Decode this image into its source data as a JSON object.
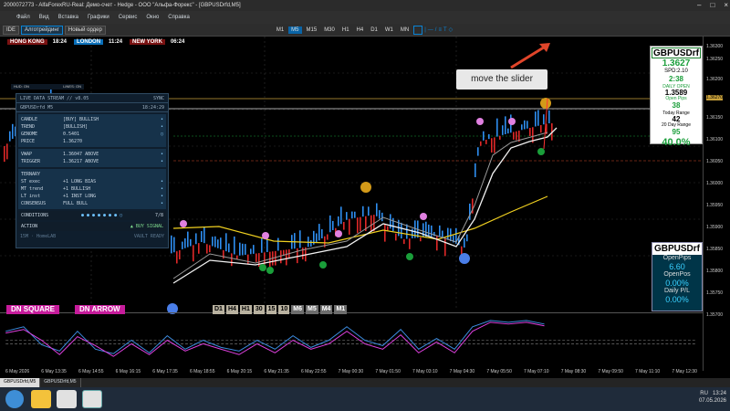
{
  "window": {
    "title": "2000072773 - AlfaForexRU-Real: Демо-счет - Hedge - ООО \"Альфа-Форекс\" - [GBPUSDrfd,M5]"
  },
  "menu": [
    "Файл",
    "Вид",
    "Вставка",
    "Графики",
    "Сервис",
    "Окно",
    "Справка"
  ],
  "toolbar": {
    "ide": "IDE",
    "algo": "Алготрейдинг",
    "new_order": "Новый ордер",
    "timeframes": [
      "M1",
      "M5",
      "M15",
      "M30",
      "H1",
      "H4",
      "D1",
      "W1",
      "MN"
    ],
    "active_tf": "M5"
  },
  "sessions": [
    {
      "name": "HONG KONG",
      "time": "18:24",
      "color": "#7a1212"
    },
    {
      "name": "LONDON",
      "time": "11:24",
      "color": "#0a6fb8"
    },
    {
      "name": "NEW YORK",
      "time": "06:24",
      "color": "#7a1212"
    }
  ],
  "hud": {
    "left": "HUD: ON",
    "right": "LINES: ON"
  },
  "panel": {
    "header": "LIVE DATA STREAM // v8.05",
    "header_right": "SYNC",
    "symbol": "GBPUSDrfd  M5",
    "time": "18:24:29",
    "rows1": [
      {
        "k": "CANDLE",
        "v": "[BUY]  BULLISH",
        "d": "•"
      },
      {
        "k": "TREND",
        "v": "[BULLISH]",
        "d": "•"
      },
      {
        "k": "GENOME",
        "v": "0.5401",
        "d": "○"
      },
      {
        "k": "PRICE",
        "v": "1.36270",
        "d": ""
      }
    ],
    "rows2": [
      {
        "k": "VWAP",
        "v": "1.36047  ABOVE",
        "d": "•"
      },
      {
        "k": "TRIGGER",
        "v": "1.36217  ABOVE",
        "d": "•"
      }
    ],
    "ternary_label": "TERNARY",
    "rows3": [
      {
        "k": "ST  exec",
        "v": "+1  LONG BIAS",
        "d": "•"
      },
      {
        "k": "MT  trend",
        "v": "+1  BULLISH",
        "d": "•"
      },
      {
        "k": "LT  inst",
        "v": "+1  INST LONG",
        "d": "•"
      },
      {
        "k": "CONSENSUS",
        "v": "FULL BULL",
        "d": "•"
      }
    ],
    "conditions_label": "CONDITIONS",
    "conditions_count": "7/8",
    "action_label": "ACTION",
    "action_value": "▲  BUY SIGNAL",
    "footer_left": "15M · HomeLAB",
    "footer_right": "VAULT READY"
  },
  "tags": {
    "dn_square": "DN SQUARE",
    "dn_arrow": "DN ARROW"
  },
  "tf_buttons": [
    "D1",
    "H4",
    "H1",
    "30",
    "15",
    "10",
    "M6",
    "M5",
    "M4",
    "M1"
  ],
  "tooltip": "move the slider",
  "info1": {
    "symbol": "GBPUSDrf",
    "price": "1.3627",
    "spd": "SPD:2.10",
    "timer": "2:38",
    "daily_open_label": "DAILY OPEN",
    "daily_open": "1.3589",
    "open_pips_label": "Open Pips",
    "open_pips": "38",
    "today_range_label": "Today Range",
    "today_range": "42",
    "day20_label": "20 Day Range",
    "day20": "95",
    "pct": "40.0%"
  },
  "info2": {
    "symbol": "GBPUSDrf",
    "open_pips_label": "OpenPips",
    "open_pips": "6.60",
    "open_pos_label": "OpenPos",
    "open_pos": "0.00%",
    "daily_pl_label": "Daily P/L",
    "daily_pl": "0.00%"
  },
  "price_axis": [
    "1.36300",
    "1.36270",
    "1.36250",
    "1.36200",
    "1.36150",
    "1.36100",
    "1.36050",
    "1.36000",
    "1.35950",
    "1.35900",
    "1.35850",
    "1.35800",
    "1.35750",
    "1.35700"
  ],
  "time_axis": [
    "6 May 2026",
    "6 May 13:35",
    "6 May 14:55",
    "6 May 16:15",
    "6 May 17:35",
    "6 May 18:55",
    "6 May 20:15",
    "6 May 21:35",
    "6 May 22:55",
    "7 May 00:30",
    "7 May 01:50",
    "7 May 03:10",
    "7 May 04:30",
    "7 May 05:50",
    "7 May 07:10",
    "7 May 08:30",
    "7 May 09:50",
    "7 May 11:10",
    "7 May 12:30"
  ],
  "chart_tabs": [
    "GBPUSDrfd,M5",
    "GBPUSDrfd,M5"
  ],
  "taskbar": {
    "lang": "RU",
    "time": "13:24",
    "date": "07.05.2026"
  }
}
